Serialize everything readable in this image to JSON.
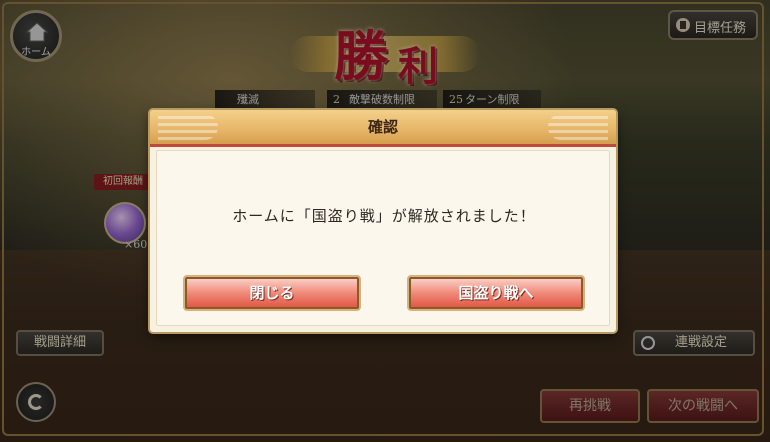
{
  "top_left": {
    "home_label": "ホーム"
  },
  "victory": {
    "char1": "勝",
    "char2": "利"
  },
  "goal_button": {
    "label": "目標任務"
  },
  "conditions": [
    {
      "num": "",
      "label": "殲滅"
    },
    {
      "num": "2",
      "label": "敵撃破数制限"
    },
    {
      "num": "25",
      "label": "ターン制限"
    }
  ],
  "reward": {
    "tag": "初回報酬",
    "count": "×60"
  },
  "left_buttons": {
    "battle_detail": "戦闘詳細"
  },
  "right_buttons": {
    "chain_setting": "連戦設定"
  },
  "bottom_buttons": {
    "rebattle": "再挑戦",
    "next_battle": "次の戦闘へ"
  },
  "dialog": {
    "title": "確認",
    "message": "ホームに「国盗り戦」が解放されました！",
    "close_button": "閉じる",
    "confirm_button": "国盗り戦へ"
  },
  "colors": {
    "accent_red": "#e0503f",
    "header_gold": "#e6b567",
    "frame_gold": "#b79a62"
  }
}
